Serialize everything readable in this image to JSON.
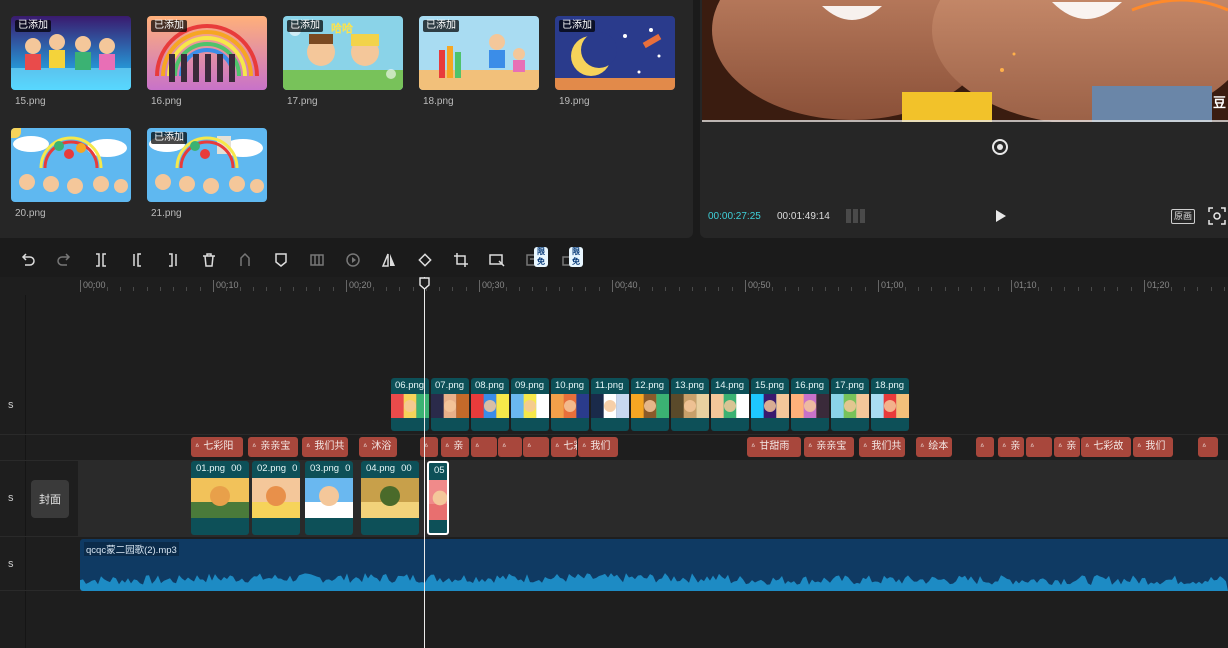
{
  "media": {
    "items": [
      {
        "name": "15.png",
        "badge": "已添加"
      },
      {
        "name": "16.png",
        "badge": "已添加"
      },
      {
        "name": "17.png",
        "badge": "已添加",
        "overlay": "哈哈"
      },
      {
        "name": "18.png",
        "badge": "已添加"
      },
      {
        "name": "19.png",
        "badge": "已添加"
      },
      {
        "name": "20.png",
        "badge": ""
      },
      {
        "name": "21.png",
        "badge": "已添加"
      }
    ]
  },
  "preview": {
    "current_time": "00:00:27:25",
    "total_time": "00:01:49:14",
    "ratio_label": "原画",
    "corner_glyph": "豆"
  },
  "toolbar": {
    "free_tag": "限免",
    "tools": [
      "undo-icon",
      "redo-icon",
      "split-icon",
      "split-left-icon",
      "split-right-icon",
      "delete-icon",
      "freeze-icon",
      "marker-icon",
      "reverse-icon",
      "play-circle-icon",
      "mirror-icon",
      "rotate-icon",
      "crop-icon",
      "auto-cut-icon",
      "text-recognize-icon",
      "smart-layout-icon"
    ]
  },
  "timeline": {
    "ruler_ticks": [
      "00:00",
      "00:10",
      "00:20",
      "00:30",
      "00:40",
      "00:50",
      "01:00",
      "01:10",
      "01:20"
    ],
    "track_labels": [
      "s",
      "s",
      "s"
    ],
    "cover_label": "封面",
    "overlay_clips": [
      "06.png",
      "07.png",
      "08.png",
      "09.png",
      "10.png",
      "11.png",
      "12.png",
      "13.png",
      "14.png",
      "15.png",
      "16.png",
      "17.png",
      "18.png"
    ],
    "main_clips": [
      "01.png",
      "02.png",
      "03.png",
      "04.png",
      "05"
    ],
    "main_clip_suffix": [
      "00",
      "0",
      "0",
      "00"
    ],
    "text_clips": [
      "七彩阳",
      "亲亲宝",
      "我们共",
      "沐浴",
      "",
      "亲",
      "",
      "",
      "",
      "七彩天",
      "我们",
      "甘甜雨",
      "亲亲宝",
      "我们共",
      "绘本",
      "",
      "亲",
      "",
      "亲",
      "七彩故",
      "我们",
      ""
    ],
    "text_icon": "ᐞ",
    "audio_name": "qcqc蒙二园歌(2).mp3"
  },
  "colors": {
    "accent": "#3fd0d9",
    "clip_teal": "#0d5058",
    "text_clip": "#a8473c",
    "audio_bg": "#0f3a63",
    "audio_wave": "#1d8bc4"
  }
}
